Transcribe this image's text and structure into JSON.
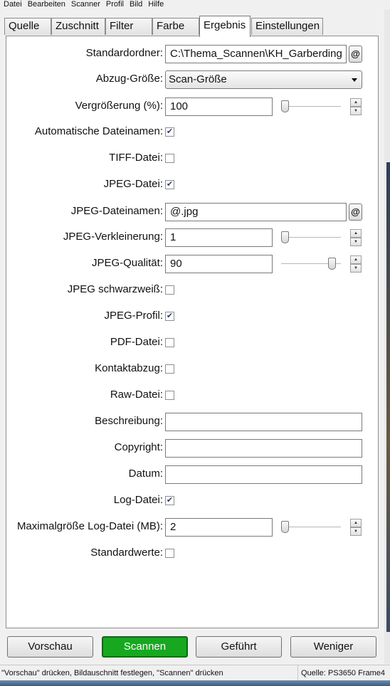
{
  "menu": [
    "Datei",
    "Bearbeiten",
    "Scanner",
    "Profil",
    "Bild",
    "Hilfe"
  ],
  "tabs": [
    {
      "label": "Quelle",
      "active": false
    },
    {
      "label": "Zuschnitt",
      "active": false
    },
    {
      "label": "Filter",
      "active": false
    },
    {
      "label": "Farbe",
      "active": false
    },
    {
      "label": "Ergebnis",
      "active": true
    },
    {
      "label": "Einstellungen",
      "active": false
    }
  ],
  "form": {
    "standardordner": {
      "label": "Standardordner:",
      "value": "C:\\Thema_Scannen\\KH_Garberding",
      "button": "@"
    },
    "abzug_groesse": {
      "label": "Abzug-Größe:",
      "value": "Scan-Größe"
    },
    "vergroesserung": {
      "label": "Vergrößerung (%):",
      "value": "100",
      "slider_fraction": 0.0
    },
    "auto_namen": {
      "label": "Automatische Dateinamen:",
      "checked": true
    },
    "tiff": {
      "label": "TIFF-Datei:",
      "checked": false
    },
    "jpeg": {
      "label": "JPEG-Datei:",
      "checked": true
    },
    "jpeg_namen": {
      "label": "JPEG-Dateinamen:",
      "value": "@.jpg",
      "button": "@"
    },
    "jpeg_verkleinerung": {
      "label": "JPEG-Verkleinerung:",
      "value": "1",
      "slider_fraction": 0.0
    },
    "jpeg_qualitaet": {
      "label": "JPEG-Qualität:",
      "value": "90",
      "slider_fraction": 0.9
    },
    "jpeg_sw": {
      "label": "JPEG schwarzweiß:",
      "checked": false
    },
    "jpeg_profil": {
      "label": "JPEG-Profil:",
      "checked": true
    },
    "pdf": {
      "label": "PDF-Datei:",
      "checked": false
    },
    "kontaktabzug": {
      "label": "Kontaktabzug:",
      "checked": false
    },
    "raw": {
      "label": "Raw-Datei:",
      "checked": false
    },
    "beschreibung": {
      "label": "Beschreibung:",
      "value": ""
    },
    "copyright": {
      "label": "Copyright:",
      "value": ""
    },
    "datum": {
      "label": "Datum:",
      "value": ""
    },
    "log": {
      "label": "Log-Datei:",
      "checked": true
    },
    "log_max": {
      "label": "Maximalgröße Log-Datei (MB):",
      "value": "2",
      "slider_fraction": 0.0
    },
    "standardwerte": {
      "label": "Standardwerte:",
      "checked": false
    }
  },
  "buttons": {
    "vorschau": "Vorschau",
    "scannen": "Scannen",
    "gefuehrt": "Geführt",
    "weniger": "Weniger"
  },
  "status": {
    "message": "\"Vorschau\" drücken, Bildauschnitt festlegen, \"Scannen\" drücken",
    "source": "Quelle: PS3650 Frame4"
  },
  "colors": {
    "scan_button": "#17a820"
  }
}
